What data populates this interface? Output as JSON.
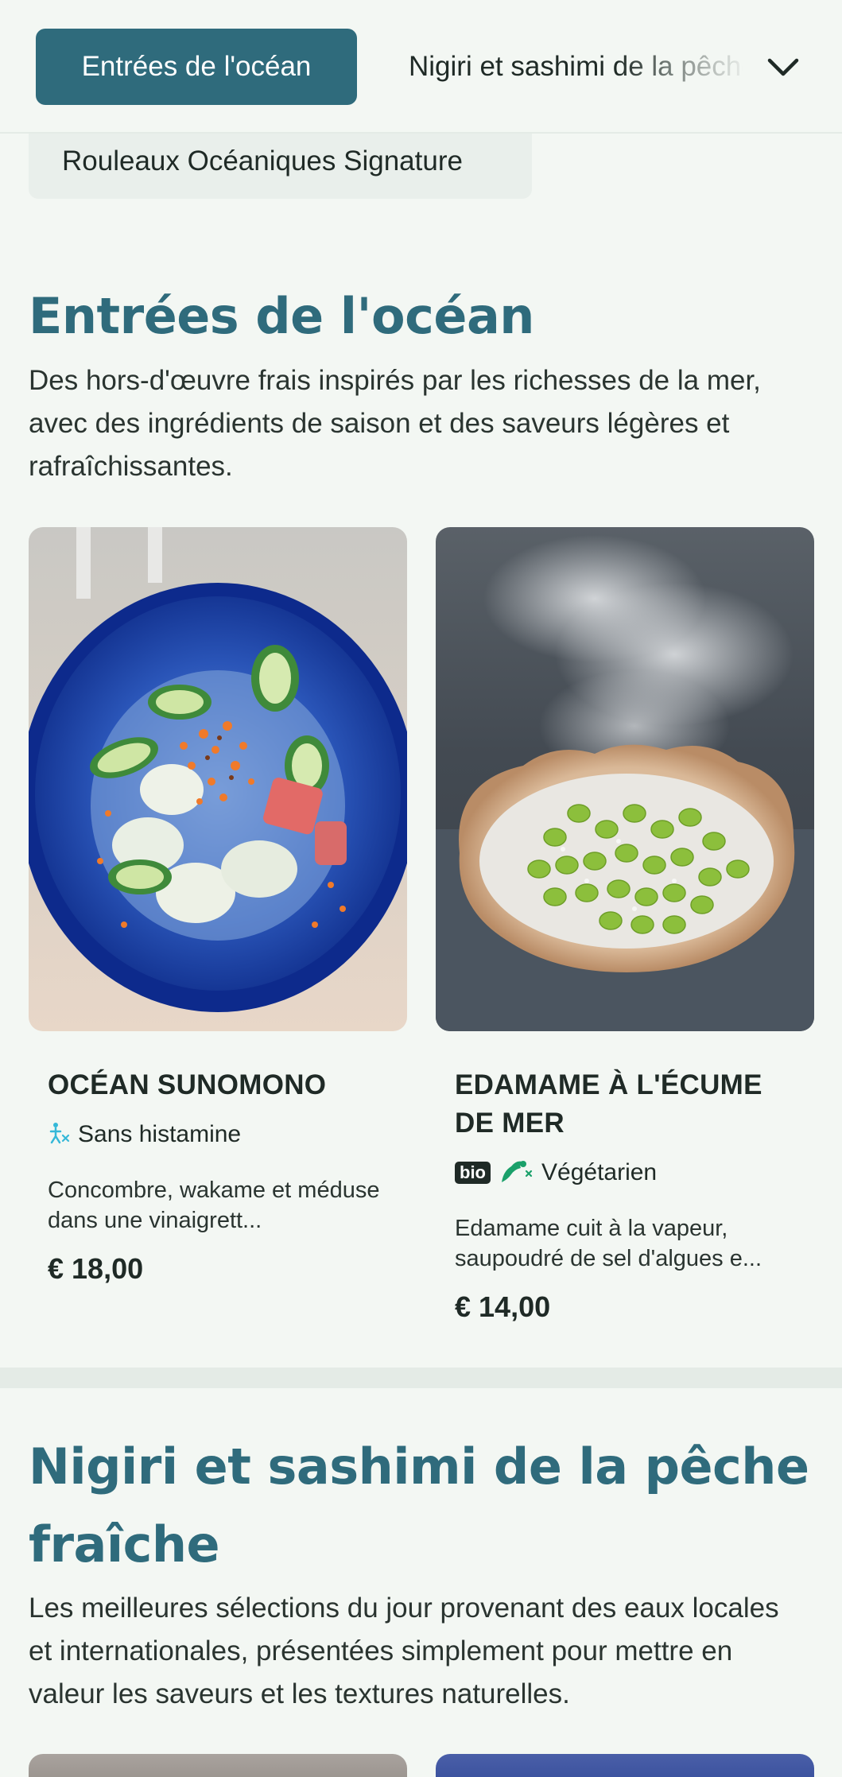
{
  "nav": {
    "active_label": "Entrées de l'océan",
    "next_label": "Nigiri et sashimi de la pêche fraîche",
    "second_row_label": "Rouleaux Océaniques Signature",
    "expand_icon": "chevron-down-icon"
  },
  "sections": [
    {
      "title": "Entrées de l'océan",
      "description": "Des hors-d'œuvre frais inspirés par les richesses de la mer, avec des ingrédients de saison et des saveurs légères et rafraîchissantes.",
      "items": [
        {
          "name": "OCÉAN SUNOMONO",
          "tags": [
            {
              "icon": "histamine-free-icon",
              "label": "Sans histamine"
            }
          ],
          "description": "Concombre, wakame et méduse dans une vinaigrett...",
          "price": "€ 18,00"
        },
        {
          "name": "EDAMAME À L'ÉCUME DE MER",
          "tags": [
            {
              "badge": "bio"
            },
            {
              "icon": "vegetarian-icon",
              "label": "Végétarien"
            }
          ],
          "description": "Edamame cuit à la vapeur, saupoudré de sel d'algues e...",
          "price": "€ 14,00"
        }
      ]
    },
    {
      "title": "Nigiri et sashimi de la pêche fraîche",
      "description": "Les meilleures sélections du jour provenant des eaux locales et internationales, présentées simplement pour mettre en valeur les saveurs et les textures naturelles."
    }
  ],
  "colors": {
    "accent": "#2f6b7c",
    "background": "#f3f7f3",
    "text": "#1f2a26",
    "vegetarian_green": "#1aa06a",
    "histamine_blue": "#35b8d8"
  }
}
